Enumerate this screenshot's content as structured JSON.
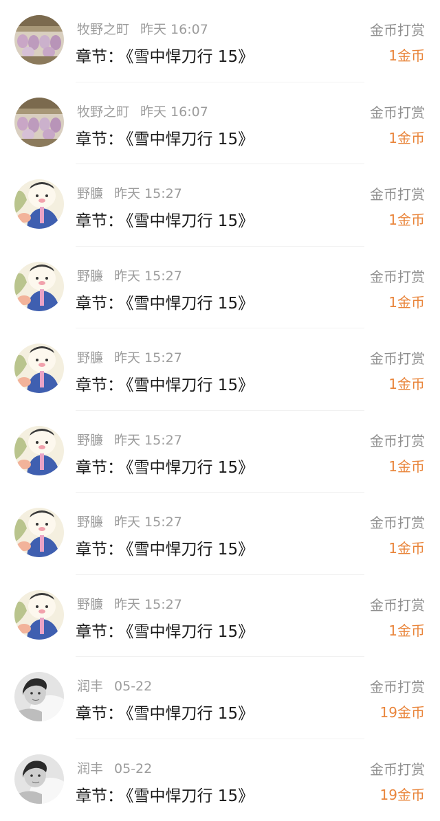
{
  "rows": [
    {
      "user": "牧野之町",
      "time": "昨天 16:07",
      "chapter_prefix": "章节：",
      "chapter": "《雪中悍刀行 15》",
      "type": "金币打赏",
      "amount": "1金币",
      "avatar": "crowd-avatar"
    },
    {
      "user": "牧野之町",
      "time": "昨天 16:07",
      "chapter_prefix": "章节：",
      "chapter": "《雪中悍刀行 15》",
      "type": "金币打赏",
      "amount": "1金币",
      "avatar": "crowd-avatar"
    },
    {
      "user": "野臁",
      "time": "昨天 15:27",
      "chapter_prefix": "章节：",
      "chapter": "《雪中悍刀行 15》",
      "type": "金币打赏",
      "amount": "1金币",
      "avatar": "cartoon-avatar"
    },
    {
      "user": "野臁",
      "time": "昨天 15:27",
      "chapter_prefix": "章节：",
      "chapter": "《雪中悍刀行 15》",
      "type": "金币打赏",
      "amount": "1金币",
      "avatar": "cartoon-avatar"
    },
    {
      "user": "野臁",
      "time": "昨天 15:27",
      "chapter_prefix": "章节：",
      "chapter": "《雪中悍刀行 15》",
      "type": "金币打赏",
      "amount": "1金币",
      "avatar": "cartoon-avatar"
    },
    {
      "user": "野臁",
      "time": "昨天 15:27",
      "chapter_prefix": "章节：",
      "chapter": "《雪中悍刀行 15》",
      "type": "金币打赏",
      "amount": "1金币",
      "avatar": "cartoon-avatar"
    },
    {
      "user": "野臁",
      "time": "昨天 15:27",
      "chapter_prefix": "章节：",
      "chapter": "《雪中悍刀行 15》",
      "type": "金币打赏",
      "amount": "1金币",
      "avatar": "cartoon-avatar"
    },
    {
      "user": "野臁",
      "time": "昨天 15:27",
      "chapter_prefix": "章节：",
      "chapter": "《雪中悍刀行 15》",
      "type": "金币打赏",
      "amount": "1金币",
      "avatar": "cartoon-avatar"
    },
    {
      "user": "润丰",
      "time": "05-22",
      "chapter_prefix": "章节：",
      "chapter": "《雪中悍刀行 15》",
      "type": "金币打赏",
      "amount": "19金币",
      "avatar": "photo-avatar"
    },
    {
      "user": "润丰",
      "time": "05-22",
      "chapter_prefix": "章节：",
      "chapter": "《雪中悍刀行 15》",
      "type": "金币打赏",
      "amount": "19金币",
      "avatar": "photo-avatar"
    }
  ],
  "colors": {
    "amount": "#e9853b",
    "meta": "#9c9c9c",
    "chapter": "#1a1a1a",
    "type": "#8e8e8e"
  }
}
